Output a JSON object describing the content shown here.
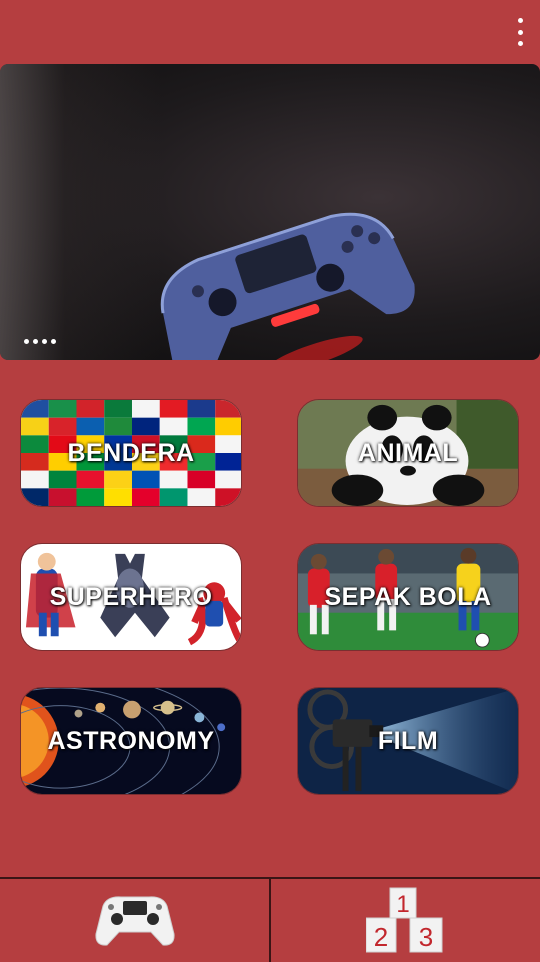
{
  "header": {
    "menu_icon": "more-vert-icon"
  },
  "banner": {
    "image": "game-controller-photo",
    "page_count": 4
  },
  "categories": [
    {
      "label": "BENDERA",
      "image": "world-flags"
    },
    {
      "label": "ANIMAL",
      "image": "panda"
    },
    {
      "label": "SUPERHERO",
      "image": "superheroes"
    },
    {
      "label": "SEPAK BOLA",
      "image": "football-players"
    },
    {
      "label": "ASTRONOMY",
      "image": "solar-system"
    },
    {
      "label": "FILM",
      "image": "film-projector"
    }
  ],
  "bottom_nav": [
    {
      "icon": "gamepad-icon"
    },
    {
      "icon": "podium-leaderboard-icon",
      "ranks": [
        "1",
        "2",
        "3"
      ]
    }
  ],
  "colors": {
    "background": "#b53e40",
    "divider": "#3a1516"
  }
}
